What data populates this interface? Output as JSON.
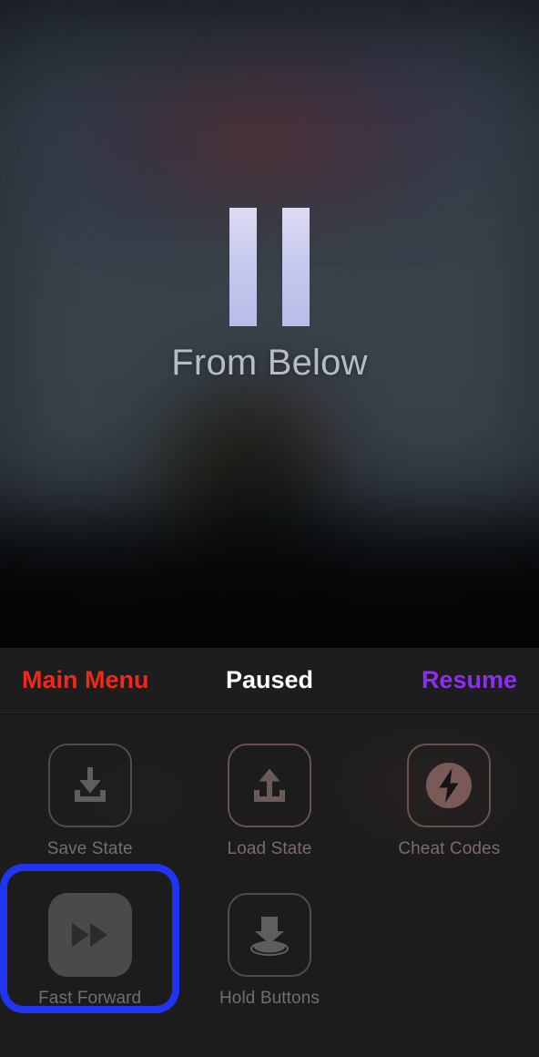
{
  "game": {
    "title": "From Below",
    "pause_icon": "pause-icon"
  },
  "toolbar": {
    "main_menu_label": "Main Menu",
    "status_title": "Paused",
    "resume_label": "Resume",
    "colors": {
      "main_menu": "#f02819",
      "status": "#ffffff",
      "resume": "#8b2ef0",
      "background": "#1d1d1d"
    }
  },
  "panel": {
    "background": "#1c1c1c",
    "selection_ring_color": "#1f35f2",
    "actions": [
      {
        "label": "Save State",
        "icon": "download-arrow-tray-icon",
        "style": "outline",
        "selected": false
      },
      {
        "label": "Load State",
        "icon": "upload-arrow-tray-icon",
        "style": "outline-tinted",
        "selected": false
      },
      {
        "label": "Cheat Codes",
        "icon": "bolt-circle-icon",
        "style": "outline-tinted",
        "selected": false
      },
      {
        "label": "Fast Forward",
        "icon": "double-triangle-forward-icon",
        "style": "filled",
        "selected": true
      },
      {
        "label": "Hold Buttons",
        "icon": "arrow-onto-button-icon",
        "style": "outline",
        "selected": false
      }
    ]
  }
}
